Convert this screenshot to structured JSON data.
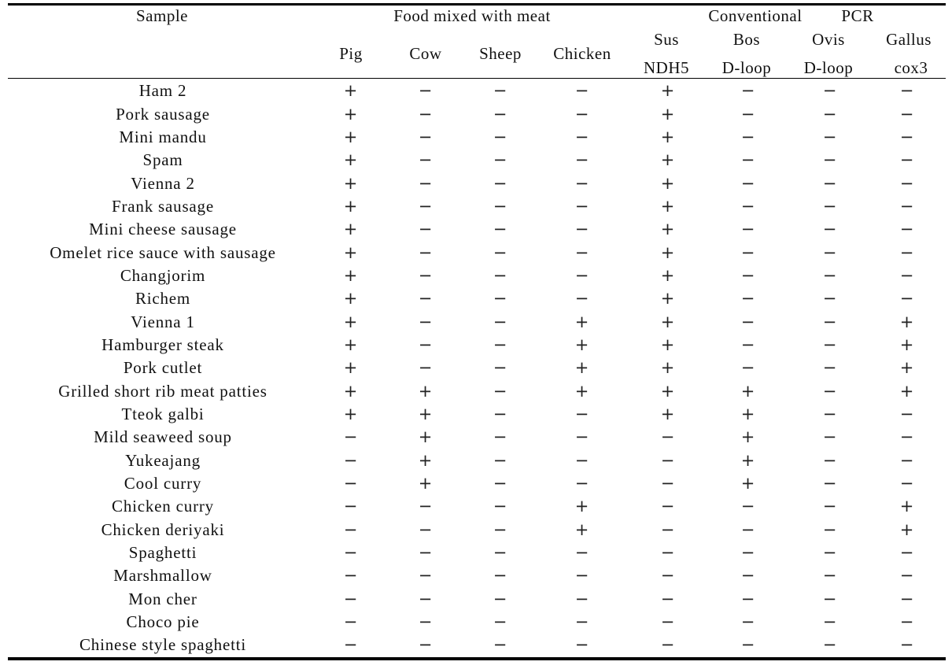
{
  "table": {
    "header": {
      "sample": "Sample",
      "group_food": "Food mixed with meat",
      "group_pcr_1": "Conventional",
      "group_pcr_2": "PCR",
      "food_columns": [
        "Pig",
        "Cow",
        "Sheep",
        "Chicken"
      ],
      "pcr_columns": [
        {
          "line1": "Sus",
          "line2": "NDH5"
        },
        {
          "line1": "Bos",
          "line2": "D-loop"
        },
        {
          "line1": "Ovis",
          "line2": "D-loop"
        },
        {
          "line1": "Gallus",
          "line2": "cox3"
        }
      ]
    },
    "rows": [
      {
        "sample": "Ham 2",
        "values": [
          "+",
          "−",
          "−",
          "−",
          "+",
          "−",
          "−",
          "−"
        ]
      },
      {
        "sample": "Pork sausage",
        "values": [
          "+",
          "−",
          "−",
          "−",
          "+",
          "−",
          "−",
          "−"
        ]
      },
      {
        "sample": "Mini mandu",
        "values": [
          "+",
          "−",
          "−",
          "−",
          "+",
          "−",
          "−",
          "−"
        ]
      },
      {
        "sample": "Spam",
        "values": [
          "+",
          "−",
          "−",
          "−",
          "+",
          "−",
          "−",
          "−"
        ]
      },
      {
        "sample": "Vienna 2",
        "values": [
          "+",
          "−",
          "−",
          "−",
          "+",
          "−",
          "−",
          "−"
        ]
      },
      {
        "sample": "Frank  sausage",
        "values": [
          "+",
          "−",
          "−",
          "−",
          "+",
          "−",
          "−",
          "−"
        ]
      },
      {
        "sample": "Mini cheese sausage",
        "values": [
          "+",
          "−",
          "−",
          "−",
          "+",
          "−",
          "−",
          "−"
        ]
      },
      {
        "sample": "Omelet rice sauce with sausage",
        "values": [
          "+",
          "−",
          "−",
          "−",
          "+",
          "−",
          "−",
          "−"
        ]
      },
      {
        "sample": "Changjorim",
        "values": [
          "+",
          "−",
          "−",
          "−",
          "+",
          "−",
          "−",
          "−"
        ]
      },
      {
        "sample": "Richem",
        "values": [
          "+",
          "−",
          "−",
          "−",
          "+",
          "−",
          "−",
          "−"
        ]
      },
      {
        "sample": "Vienna 1",
        "values": [
          "+",
          "−",
          "−",
          "+",
          "+",
          "−",
          "−",
          "+"
        ]
      },
      {
        "sample": "Hamburger steak",
        "values": [
          "+",
          "−",
          "−",
          "+",
          "+",
          "−",
          "−",
          "+"
        ]
      },
      {
        "sample": "Pork cutlet",
        "values": [
          "+",
          "−",
          "−",
          "+",
          "+",
          "−",
          "−",
          "+"
        ]
      },
      {
        "sample": "Grilled short rib meat patties",
        "values": [
          "+",
          "+",
          "−",
          "+",
          "+",
          "+",
          "−",
          "+"
        ]
      },
      {
        "sample": "Tteok galbi",
        "values": [
          "+",
          "+",
          "−",
          "−",
          "+",
          "+",
          "−",
          "−"
        ]
      },
      {
        "sample": "Mild seaweed soup",
        "values": [
          "−",
          "+",
          "−",
          "−",
          "−",
          "+",
          "−",
          "−"
        ]
      },
      {
        "sample": "Yukeajang",
        "values": [
          "−",
          "+",
          "−",
          "−",
          "−",
          "+",
          "−",
          "−"
        ]
      },
      {
        "sample": "Cool curry",
        "values": [
          "−",
          "+",
          "−",
          "−",
          "−",
          "+",
          "−",
          "−"
        ]
      },
      {
        "sample": "Chicken curry",
        "values": [
          "−",
          "−",
          "−",
          "+",
          "−",
          "−",
          "−",
          "+"
        ]
      },
      {
        "sample": "Chicken deriyaki",
        "values": [
          "−",
          "−",
          "−",
          "+",
          "−",
          "−",
          "−",
          "+"
        ]
      },
      {
        "sample": "Spaghetti",
        "values": [
          "−",
          "−",
          "−",
          "−",
          "−",
          "−",
          "−",
          "−"
        ]
      },
      {
        "sample": "Marshmallow",
        "values": [
          "−",
          "−",
          "−",
          "−",
          "−",
          "−",
          "−",
          "−"
        ]
      },
      {
        "sample": "Mon cher",
        "values": [
          "−",
          "−",
          "−",
          "−",
          "−",
          "−",
          "−",
          "−"
        ]
      },
      {
        "sample": "Choco pie",
        "values": [
          "−",
          "−",
          "−",
          "−",
          "−",
          "−",
          "−",
          "−"
        ]
      },
      {
        "sample": "Chinese style spaghetti",
        "values": [
          "−",
          "−",
          "−",
          "−",
          "−",
          "−",
          "−",
          "−"
        ]
      }
    ]
  }
}
